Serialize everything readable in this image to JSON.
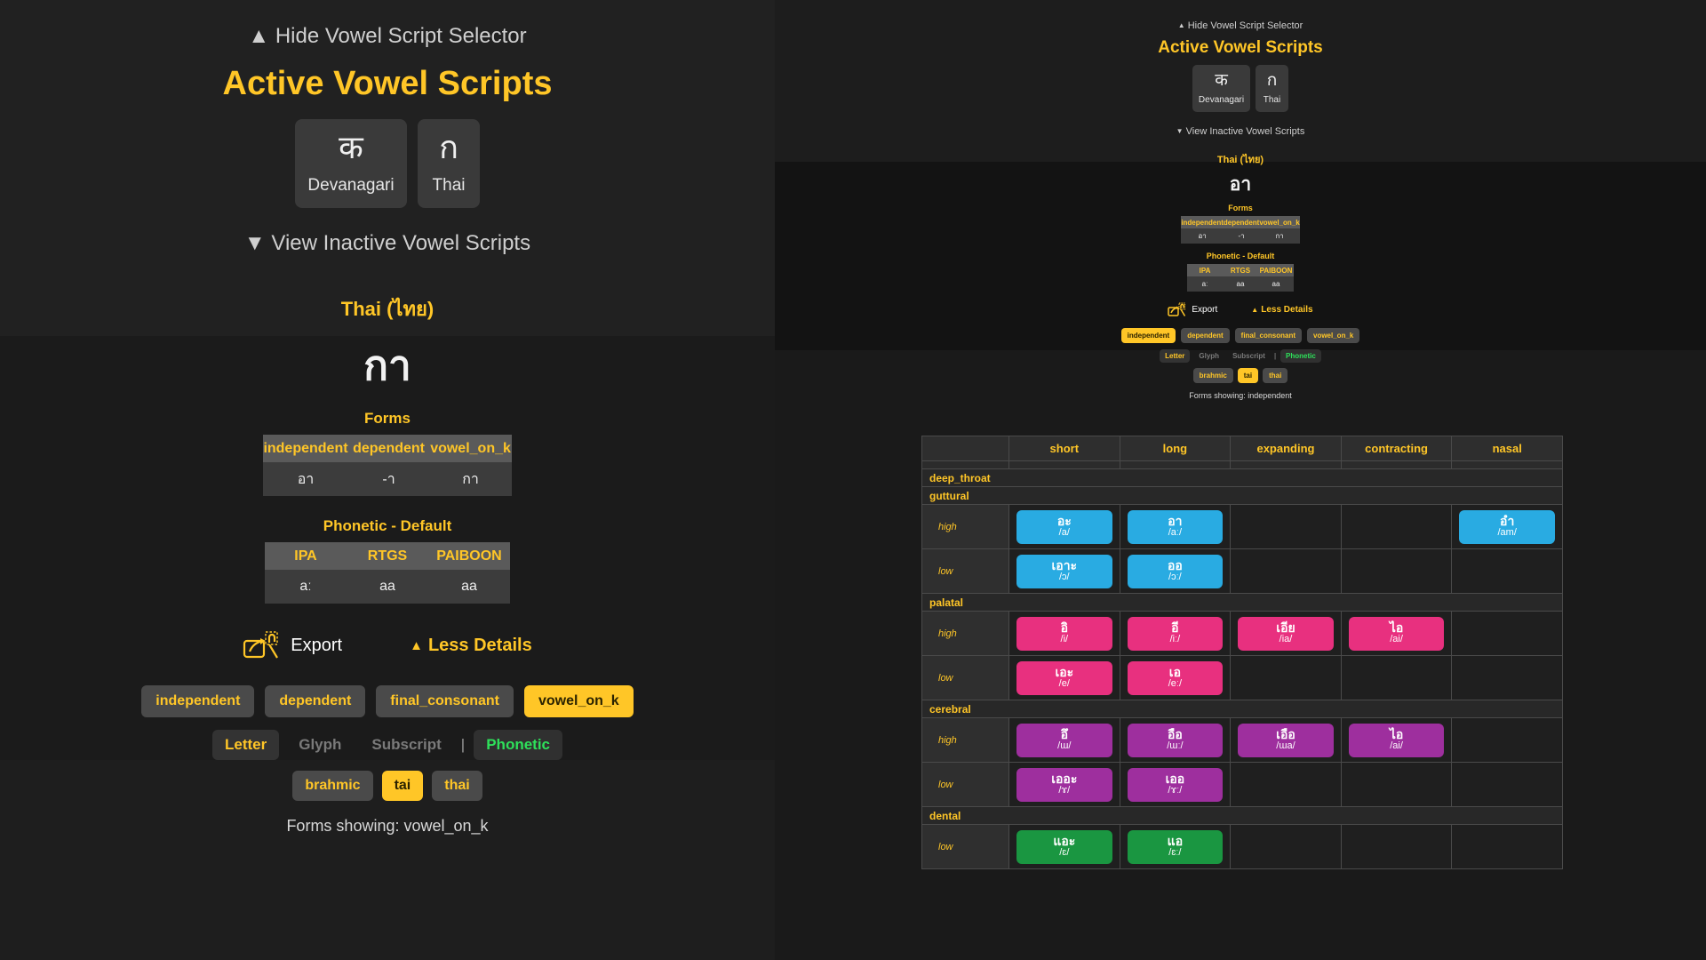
{
  "left_panel": {
    "hide_selector_label": "Hide Vowel Script Selector",
    "active_scripts_title": "Active Vowel Scripts",
    "scripts": [
      {
        "glyph": "क",
        "label": "Devanagari"
      },
      {
        "glyph": "ก",
        "label": "Thai"
      }
    ],
    "view_inactive_label": "View Inactive Vowel Scripts",
    "script_title": "Thai (ไทย)",
    "big_glyph": "กา",
    "forms_caption": "Forms",
    "forms_headers": [
      "independent",
      "dependent",
      "vowel_on_k"
    ],
    "forms_values": [
      "อา",
      "-า",
      "กา"
    ],
    "phonetic_caption": "Phonetic - Default",
    "phonetic_headers": [
      "IPA",
      "RTGS",
      "PAIBOON"
    ],
    "phonetic_values": [
      "aː",
      "aa",
      "aa"
    ],
    "export_label": "Export",
    "less_details_label": "Less Details",
    "form_chips": [
      {
        "label": "independent",
        "active": false
      },
      {
        "label": "dependent",
        "active": false
      },
      {
        "label": "final_consonant",
        "active": false
      },
      {
        "label": "vowel_on_k",
        "active": true
      }
    ],
    "view_chips": [
      {
        "label": "Letter",
        "state": "flat-active"
      },
      {
        "label": "Glyph",
        "state": "muted"
      },
      {
        "label": "Subscript",
        "state": "muted"
      },
      {
        "label": "|",
        "state": "sep"
      },
      {
        "label": "Phonetic",
        "state": "green"
      }
    ],
    "family_chips": [
      {
        "label": "brahmic",
        "active": false
      },
      {
        "label": "tai",
        "active": true
      },
      {
        "label": "thai",
        "active": false
      }
    ],
    "forms_showing": "Forms showing: vowel_on_k"
  },
  "right_panel": {
    "hide_selector_label": "Hide Vowel Script Selector",
    "active_scripts_title": "Active Vowel Scripts",
    "scripts": [
      {
        "glyph": "क",
        "label": "Devanagari"
      },
      {
        "glyph": "ก",
        "label": "Thai"
      }
    ],
    "view_inactive_label": "View Inactive Vowel Scripts",
    "script_title": "Thai (ไทย)",
    "big_glyph": "อา",
    "forms_caption": "Forms",
    "forms_headers": [
      "independent",
      "dependent",
      "vowel_on_k"
    ],
    "forms_values": [
      "อา",
      "-า",
      "กา"
    ],
    "phonetic_caption": "Phonetic - Default",
    "phonetic_headers": [
      "IPA",
      "RTGS",
      "PAIBOON"
    ],
    "phonetic_values": [
      "aː",
      "aa",
      "aa"
    ],
    "export_label": "Export",
    "less_details_label": "Less Details",
    "form_chips": [
      {
        "label": "independent",
        "active": true
      },
      {
        "label": "dependent",
        "active": false
      },
      {
        "label": "final_consonant",
        "active": false
      },
      {
        "label": "vowel_on_k",
        "active": false
      }
    ],
    "view_chips": [
      {
        "label": "Letter",
        "state": "flat-active"
      },
      {
        "label": "Glyph",
        "state": "muted"
      },
      {
        "label": "Subscript",
        "state": "muted"
      },
      {
        "label": "|",
        "state": "sep"
      },
      {
        "label": "Phonetic",
        "state": "green"
      }
    ],
    "family_chips": [
      {
        "label": "brahmic",
        "active": false
      },
      {
        "label": "tai",
        "active": true
      },
      {
        "label": "thai",
        "active": false
      }
    ],
    "forms_showing": "Forms showing: independent"
  },
  "vowel_table": {
    "columns": [
      "",
      "short",
      "long",
      "expanding",
      "contracting",
      "nasal"
    ],
    "colors": {
      "guttural": "#29abe2",
      "palatal": "#e8307f",
      "cerebral": "#9e2f9e",
      "dental": "#1a9641"
    },
    "groups": [
      {
        "name": "deep_throat",
        "rows": []
      },
      {
        "name": "guttural",
        "color": "#29abe2",
        "rows": [
          {
            "label": "high",
            "cells": [
              {
                "glyph": "อะ",
                "phonetic": "/a/"
              },
              {
                "glyph": "อา",
                "phonetic": "/aː/"
              },
              null,
              null,
              {
                "glyph": "อำ",
                "phonetic": "/am/"
              }
            ]
          },
          {
            "label": "low",
            "cells": [
              {
                "glyph": "เอาะ",
                "phonetic": "/ɔ/"
              },
              {
                "glyph": "ออ",
                "phonetic": "/ɔː/"
              },
              null,
              null,
              null
            ]
          }
        ]
      },
      {
        "name": "palatal",
        "color": "#e8307f",
        "rows": [
          {
            "label": "high",
            "cells": [
              {
                "glyph": "อิ",
                "phonetic": "/i/"
              },
              {
                "glyph": "อี",
                "phonetic": "/iː/"
              },
              {
                "glyph": "เอีย",
                "phonetic": "/ia/"
              },
              {
                "glyph": "ไอ",
                "phonetic": "/ai/"
              },
              null
            ]
          },
          {
            "label": "low",
            "cells": [
              {
                "glyph": "เอะ",
                "phonetic": "/e/"
              },
              {
                "glyph": "เอ",
                "phonetic": "/eː/"
              },
              null,
              null,
              null
            ]
          }
        ]
      },
      {
        "name": "cerebral",
        "color": "#9e2f9e",
        "rows": [
          {
            "label": "high",
            "cells": [
              {
                "glyph": "อึ",
                "phonetic": "/ɯ/"
              },
              {
                "glyph": "อือ",
                "phonetic": "/ɯː/"
              },
              {
                "glyph": "เอือ",
                "phonetic": "/ɯa/"
              },
              {
                "glyph": "ไอ",
                "phonetic": "/ai/"
              },
              null
            ]
          },
          {
            "label": "low",
            "cells": [
              {
                "glyph": "เออะ",
                "phonetic": "/ɤ/"
              },
              {
                "glyph": "เออ",
                "phonetic": "/ɤː/"
              },
              null,
              null,
              null
            ]
          }
        ]
      },
      {
        "name": "dental",
        "color": "#1a9641",
        "rows": [
          {
            "label": "low",
            "cells": [
              {
                "glyph": "แอะ",
                "phonetic": "/ɛ/"
              },
              {
                "glyph": "แอ",
                "phonetic": "/ɛː/"
              },
              null,
              null,
              null
            ]
          }
        ]
      }
    ]
  }
}
